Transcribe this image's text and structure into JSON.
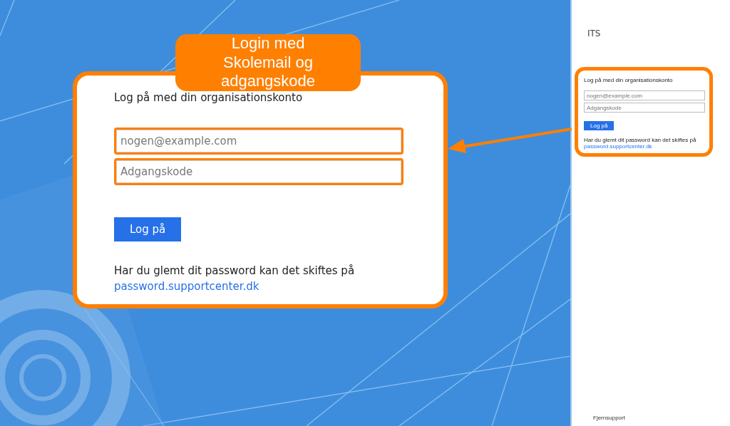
{
  "sidebar": {
    "title": "ITS",
    "login": {
      "heading": "Log på med din organisationskonto",
      "email": {
        "placeholder": "nogen@example.com"
      },
      "password": {
        "placeholder": "Adgangskode"
      },
      "button": "Log på",
      "help_text": "Har du glemt dit password kan det skiftes på",
      "help_link": "password.supportcenter.dk"
    },
    "footer_link": "Fjernsupport"
  },
  "callout": {
    "label": "Login med Skolemail og adgangskode",
    "login": {
      "heading": "Log på med din organisationskonto",
      "email": {
        "placeholder": "nogen@example.com"
      },
      "password": {
        "placeholder": "Adgangskode"
      },
      "button": "Log på",
      "help_text": "Har du glemt dit password kan det skiftes på",
      "help_link": "password.supportcenter.dk"
    }
  }
}
